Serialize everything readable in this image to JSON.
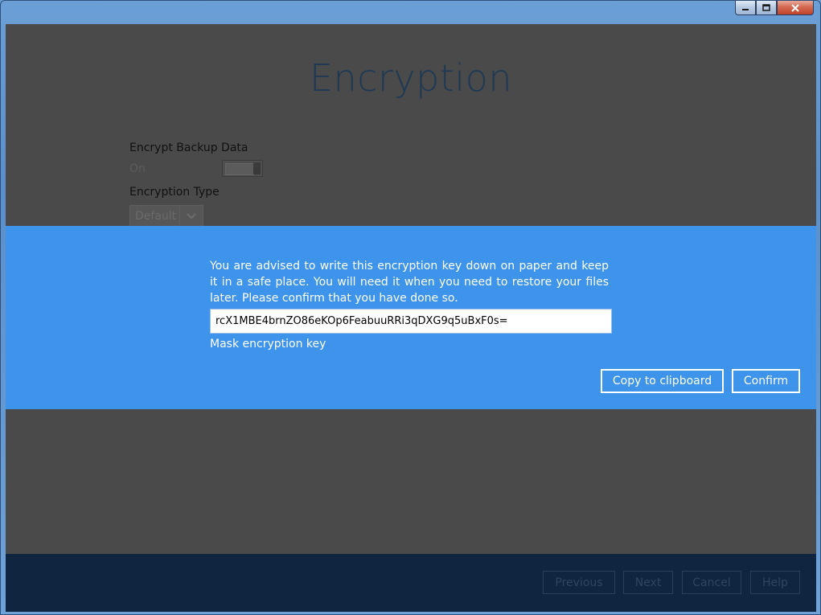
{
  "page": {
    "title": "Encryption"
  },
  "form": {
    "encrypt_label": "Encrypt Backup Data",
    "encrypt_state": "On",
    "encryption_type_label": "Encryption Type",
    "encryption_type_value": "Default"
  },
  "dialog": {
    "advice": "You are advised to write this encryption key down on paper and keep it in a safe place. You will need it when you need to restore your files later. Please confirm that you have done so.",
    "key_value": "rcX1MBE4brnZO86eKOp6FeabuuRRi3qDXG9q5uBxF0s=",
    "mask_label": "Mask encryption key",
    "copy_label": "Copy to clipboard",
    "confirm_label": "Confirm"
  },
  "footer": {
    "previous_label": "Previous",
    "next_label": "Next",
    "cancel_label": "Cancel",
    "help_label": "Help"
  },
  "colors": {
    "dialog_band": "#3d94ea",
    "overlay": "#4a4a4a",
    "footer": "#0f2540",
    "title": "#1f3954"
  },
  "icons": {
    "minimize": "minimize-icon",
    "maximize": "maximize-icon",
    "close": "close-icon",
    "dropdown": "chevron-down-icon"
  }
}
